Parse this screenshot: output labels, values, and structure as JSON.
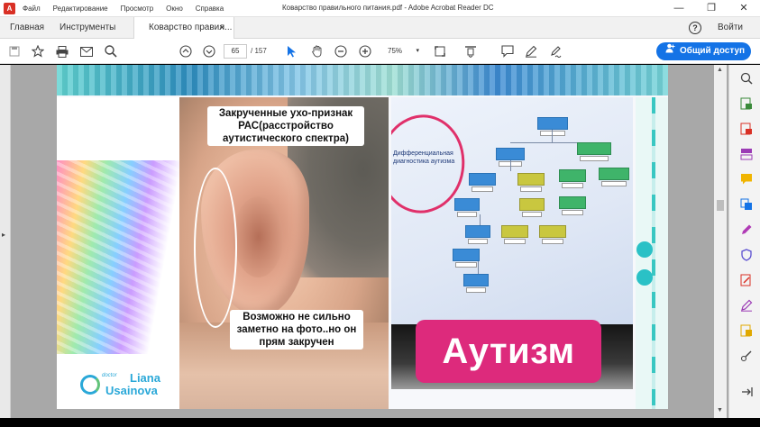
{
  "window": {
    "title": "Коварство правильного питания.pdf - Adobe Acrobat Reader DC",
    "menu": [
      "Файл",
      "Редактирование",
      "Просмотр",
      "Окно",
      "Справка"
    ],
    "controls": {
      "minimize": "—",
      "maximize": "❐",
      "close": "✕"
    }
  },
  "tabs": {
    "home": "Главная",
    "tools": "Инструменты",
    "document": "Коварство правил...",
    "close": "×",
    "help": "?",
    "signin": "Войти"
  },
  "toolbar": {
    "page_current": "65",
    "page_total": "/ 157",
    "zoom": "75%",
    "zoom_caret": "▾",
    "share_label": "Общий доступ",
    "icons": [
      "save-icon",
      "bookmark-star-icon",
      "print-icon",
      "email-icon",
      "search-icon",
      "prev-page-icon",
      "next-page-icon",
      "select-cursor-icon",
      "hand-icon",
      "zoom-out-icon",
      "zoom-in-icon",
      "fit-page-icon",
      "scroll-mode-icon",
      "comment-icon",
      "pen-icon",
      "sign-icon"
    ]
  },
  "document": {
    "caption_top": "Закрученные ухо-признак РАС(расстройство аутистического спектра)",
    "caption_bottom": "Возможно не сильно заметно на фото..но он прям закручен",
    "autism_label": "Аутизм",
    "slide_note": "Дифференциальная диагностика аутизма",
    "logo_small": "doctor",
    "logo_name1": "Liana",
    "logo_name2": "Usainova"
  },
  "colors": {
    "accent": "#1473e6",
    "autism_box": "#dd2a7c",
    "teal": "#2ac1c6",
    "pdf_red": "#d93025"
  },
  "right_tools": [
    "zoom-tool-icon",
    "export-pdf-icon",
    "create-pdf-icon",
    "organize-pages-icon",
    "comment-tool-icon",
    "combine-files-icon",
    "fill-sign-icon",
    "protect-icon",
    "edit-pdf-icon",
    "send-for-signature-icon",
    "scan-icon",
    "more-tools-icon",
    "collapse-panel-icon"
  ]
}
